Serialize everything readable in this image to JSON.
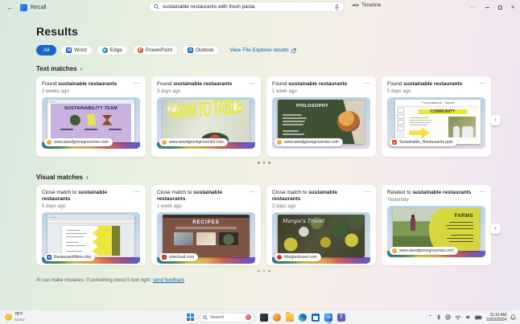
{
  "titlebar": {
    "app_name": "Recall",
    "back_glyph": "←",
    "search_value": "sustainable restaurants with fresh pasta",
    "timeline_label": "Timeline",
    "more_glyph": "⋯",
    "close_glyph": "✕"
  },
  "colors": {
    "accent": "#005FB8",
    "all_pill": "#1a66c6"
  },
  "results_title": "Results",
  "filters": {
    "all": "All",
    "word": "Word",
    "edge": "Edge",
    "powerpoint": "PowerPoint",
    "outlook": "Outlook",
    "explorer_link": "View File Explorer results"
  },
  "card_menu_glyph": "⋯",
  "chevron_glyph": "›",
  "next_glyph": "›",
  "text_section": {
    "title": "Text matches",
    "cards": [
      {
        "prefix": "Found ",
        "term": "sustainable restaurants",
        "time": "2 weeks ago",
        "source": "www.woodgrovegroceries.com"
      },
      {
        "prefix": "Found ",
        "term": "sustainable restaurants",
        "time": "3 days ago",
        "source": "www.woodgrovegroceries.com"
      },
      {
        "prefix": "Found ",
        "term": "sustainable restaurants",
        "time": "1 week ago",
        "source": "www.woodgrovegroceries.com"
      },
      {
        "prefix": "Found ",
        "term": "sustainable restaurants",
        "time": "5 days ago",
        "source": "Sustainable_Restaurants.pptx"
      }
    ]
  },
  "visual_section": {
    "title": "Visual matches",
    "cards": [
      {
        "prefix": "Close match to ",
        "term": "sustainable restaurants",
        "time": "6 days ago",
        "source": "RestaurantMenu.doc"
      },
      {
        "prefix": "Close match to ",
        "term": "sustainable restaurants",
        "time": "1 week ago",
        "source": "relecloud.com"
      },
      {
        "prefix": "Close match to ",
        "term": "sustainable restaurants",
        "time": "2 days ago",
        "source": "Margiestravel.com"
      },
      {
        "prefix": "Related to ",
        "term": "sustainable restaurants",
        "time": "Yesterday",
        "source": "www.woodgrovegroceries.com"
      }
    ]
  },
  "thumbs": {
    "t1_title": "SUSTAINABILITY TEAM",
    "t2_title": "FARM TO TABLE",
    "t3_title": "PHILOSOPHY",
    "t4_app_title": "Presentation1 · Saved",
    "t4_title": "COMMUNITY",
    "v2_title": "RECIPES",
    "v3_title": "Margie's Travel",
    "v4_title": "FARMS",
    "favicon_ppt": "P",
    "favicon_word": "W"
  },
  "feedback": {
    "text": "AI can make mistakes. If something doesn't look right, ",
    "link": "send feedback"
  },
  "taskbar": {
    "weather_temp": "78°F",
    "weather_cond": "Sunny",
    "search_placeholder": "Search",
    "time": "11:11 AM",
    "date": "10/22/2024"
  }
}
